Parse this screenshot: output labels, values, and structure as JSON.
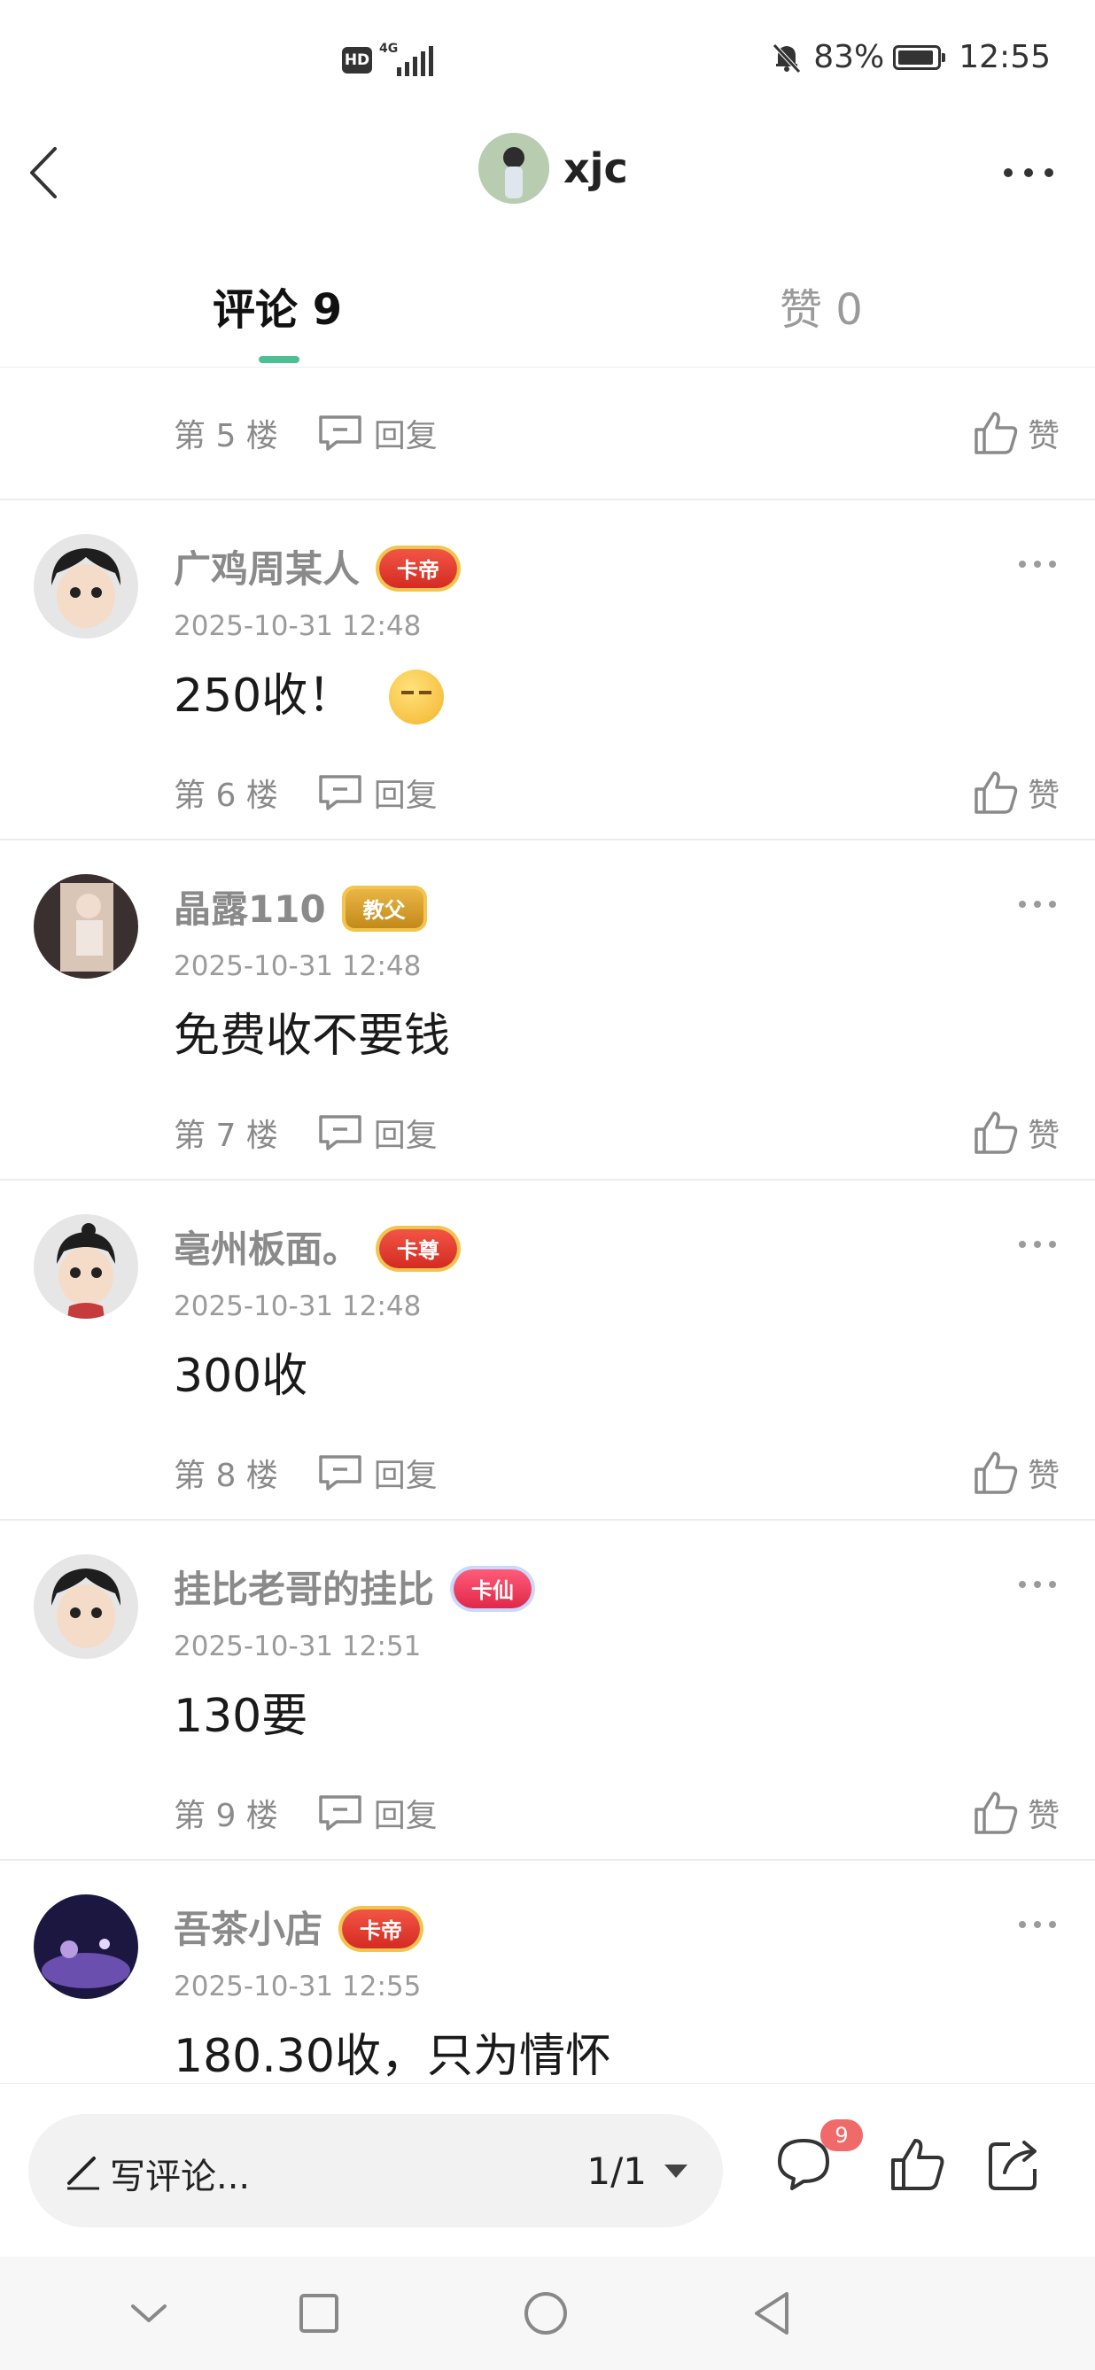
{
  "status_bar": {
    "hd": "HD",
    "network": "4G",
    "battery": "83%",
    "battery_fraction": 0.83,
    "time": "12:55"
  },
  "header": {
    "username": "xjc"
  },
  "tabs": {
    "comments": "评论 9",
    "likes": "赞 0"
  },
  "actions": {
    "reply": "回复",
    "like": "赞"
  },
  "partial_comment": {
    "floor": "第 5 楼"
  },
  "comments": [
    {
      "username": "广鸡周某人",
      "badge": "卡帝",
      "date": "2025-10-31 12:48",
      "text": "250收！",
      "floor": "第 6 楼"
    },
    {
      "username": "晶露110",
      "badge": "教父",
      "date": "2025-10-31 12:48",
      "text": "免费收不要钱",
      "floor": "第 7 楼"
    },
    {
      "username": "亳州板面。",
      "badge": "卡尊",
      "date": "2025-10-31 12:48",
      "text": "300收",
      "floor": "第 8 楼"
    },
    {
      "username": "挂比老哥的挂比",
      "badge": "卡仙",
      "date": "2025-10-31 12:51",
      "text": "130要",
      "floor": "第 9 楼"
    },
    {
      "username": "吾茶小店",
      "badge": "卡帝",
      "date": "2025-10-31 12:55",
      "text": "180.30收，只为情怀"
    }
  ],
  "input_bar": {
    "placeholder": "写评论...",
    "page": "1/1",
    "comment_badge": "9"
  },
  "colors": {
    "accent": "#4cbf95",
    "badge_red": "#f06a6a"
  },
  "icons": [
    "back-icon",
    "more-icon",
    "reply-icon",
    "like-icon",
    "pen-icon",
    "dropdown-icon",
    "comment-icon",
    "share-icon",
    "nav-back-icon",
    "nav-home-icon",
    "nav-recent-icon",
    "nav-hide-icon"
  ]
}
